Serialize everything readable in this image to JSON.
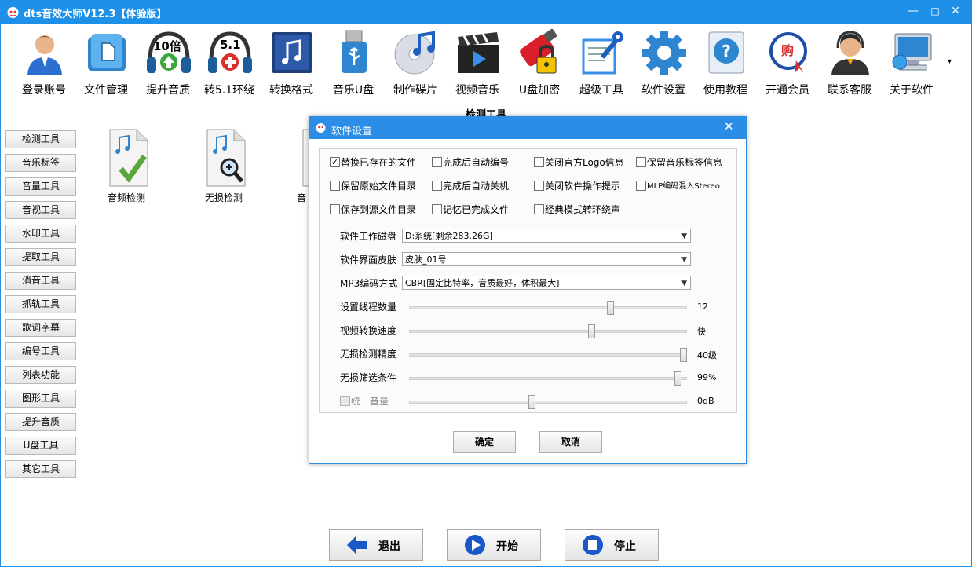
{
  "window": {
    "title": "dts音效大师V12.3【体验版】",
    "controls": [
      "—",
      "□",
      "✕"
    ]
  },
  "toolbar": {
    "items": [
      {
        "label": "登录账号",
        "icon": "user-icon"
      },
      {
        "label": "文件管理",
        "icon": "folder-icon"
      },
      {
        "label": "提升音质",
        "icon": "headphones-10x-icon",
        "badge": "10倍"
      },
      {
        "label": "转5.1环绕",
        "icon": "headphones-51-icon",
        "badge": "5.1"
      },
      {
        "label": "转换格式",
        "icon": "music-convert-icon"
      },
      {
        "label": "音乐U盘",
        "icon": "usb-drive-icon"
      },
      {
        "label": "制作碟片",
        "icon": "disc-icon"
      },
      {
        "label": "视频音乐",
        "icon": "clapper-icon"
      },
      {
        "label": "U盘加密",
        "icon": "usb-lock-icon"
      },
      {
        "label": "超级工具",
        "icon": "wrench-icon"
      },
      {
        "label": "软件设置",
        "icon": "gear-icon"
      },
      {
        "label": "使用教程",
        "icon": "help-icon"
      },
      {
        "label": "开通会员",
        "icon": "vip-icon",
        "badge": "购"
      },
      {
        "label": "联系客服",
        "icon": "support-icon"
      },
      {
        "label": "关于软件",
        "icon": "computer-icon"
      }
    ],
    "more": "▾"
  },
  "main": {
    "section_title": "检测工具",
    "sidebar": [
      "检测工具",
      "音乐标签",
      "音量工具",
      "音视工具",
      "水印工具",
      "提取工具",
      "消音工具",
      "抓轨工具",
      "歌词字幕",
      "编号工具",
      "列表功能",
      "图形工具",
      "提升音质",
      "U盘工具",
      "其它工具"
    ],
    "tools": [
      {
        "label": "音频检测",
        "icon": "audio-check-icon"
      },
      {
        "label": "无损检测",
        "icon": "lossless-check-icon"
      },
      {
        "label": "音",
        "icon": "partial-tool-icon"
      }
    ]
  },
  "dialog": {
    "title": "软件设置",
    "close": "✕",
    "checkboxes": [
      {
        "label": "替换已存在的文件",
        "checked": true
      },
      {
        "label": "完成后自动编号",
        "checked": false
      },
      {
        "label": "关闭官方Logo信息",
        "checked": false
      },
      {
        "label": "保留音乐标签信息",
        "checked": false
      },
      {
        "label": "保留原始文件目录",
        "checked": false
      },
      {
        "label": "完成后自动关机",
        "checked": false
      },
      {
        "label": "关闭软件操作提示",
        "checked": false
      },
      {
        "label": "MLP编码混入Stereo",
        "checked": false
      },
      {
        "label": "保存到源文件目录",
        "checked": false
      },
      {
        "label": "记忆已完成文件",
        "checked": false
      },
      {
        "label": "经典模式转环绕声",
        "checked": false
      }
    ],
    "selects": [
      {
        "label": "软件工作磁盘",
        "value": "D:系统[剩余283.26G]"
      },
      {
        "label": "软件界面皮肤",
        "value": "皮肤_01号"
      },
      {
        "label": "MP3编码方式",
        "value": "CBR[固定比特率，音质最好，体积最大]"
      }
    ],
    "sliders": [
      {
        "label": "设置线程数量",
        "value": "12",
        "level": 0.73,
        "disabled": false
      },
      {
        "label": "视频转换速度",
        "value": "快",
        "level": 0.66,
        "disabled": false
      },
      {
        "label": "无损检测精度",
        "value": "40级",
        "level": 1.0,
        "disabled": false
      },
      {
        "label": "无损筛选条件",
        "value": "99%",
        "level": 0.98,
        "disabled": false
      },
      {
        "label": "统一音量",
        "value": "0dB",
        "level": 0.44,
        "disabled": true,
        "checkbox": true
      }
    ],
    "ok_label": "确定",
    "cancel_label": "取消"
  },
  "bottom": {
    "exit_label": "退出",
    "start_label": "开始",
    "stop_label": "停止"
  },
  "colors": {
    "frame": "#1e90e8",
    "dialog_title": "#2b8de6",
    "arrow_blue": "#1a58c8"
  }
}
